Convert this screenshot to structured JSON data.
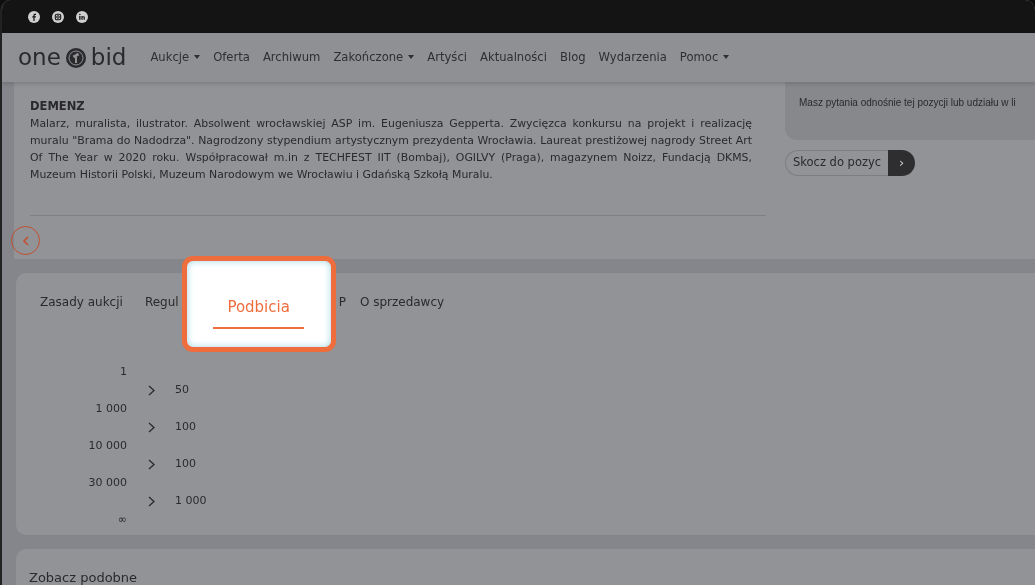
{
  "navbar": {
    "logo": {
      "left": "one",
      "right": "bid"
    },
    "items": [
      {
        "label": "Aukcje",
        "dropdown": true
      },
      {
        "label": "Oferta",
        "dropdown": false
      },
      {
        "label": "Archiwum",
        "dropdown": false
      },
      {
        "label": "Zakończone",
        "dropdown": true
      },
      {
        "label": "Artyści",
        "dropdown": false
      },
      {
        "label": "Aktualności",
        "dropdown": false
      },
      {
        "label": "Blog",
        "dropdown": false
      },
      {
        "label": "Wydarzenia",
        "dropdown": false
      },
      {
        "label": "Pomoc",
        "dropdown": true
      }
    ]
  },
  "artist": {
    "name": "DEMENZ",
    "bio": "Malarz, muralista, ilustrator. Absolwent wrocławskiej ASP im. Eugeniusza Gepperta. Zwycięzca konkursu na projekt i realizację muralu \"Brama do Nadodrza\". Nagrodzony stypendium artystycznym prezydenta Wrocławia. Laureat prestiżowej nagrody Street Art Of The Year w 2020 roku. Współpracował m.in z TECHFEST IIT (Bombaj), OGILVY (Praga), magazynem Noizz, Fundacją DKMS, Muzeum Historii Polski, Muzeum Narodowym we Wrocławiu i Gdańską Szkołą Muralu."
  },
  "side_panel": {
    "text": "Masz pytania odnośnie tej pozycji lub udziału w li",
    "jump": {
      "placeholder": "Skocz do pozyc",
      "button": "›"
    }
  },
  "tabs": [
    {
      "label": "Zasady aukcji",
      "selected": false
    },
    {
      "label": "Regul",
      "selected": false
    },
    {
      "label": "Podbicia",
      "selected": true
    },
    {
      "label": "P",
      "selected": false
    },
    {
      "label": "O sprzedawcy",
      "selected": false
    }
  ],
  "increments": {
    "thresholds": [
      "1",
      "1 000",
      "10 000",
      "30 000",
      "∞"
    ],
    "steps": [
      "50",
      "100",
      "100",
      "1 000"
    ]
  },
  "similar": {
    "title": "Zobacz podobne"
  }
}
